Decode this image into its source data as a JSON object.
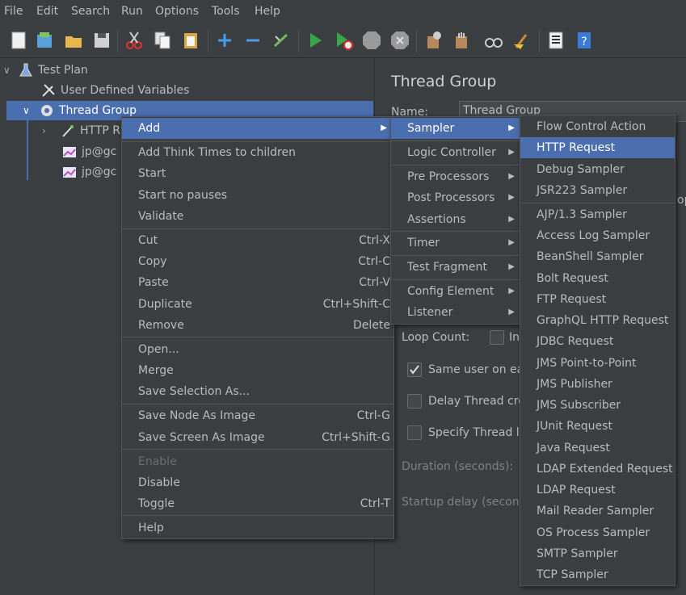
{
  "menubar": [
    "File",
    "Edit",
    "Search",
    "Run",
    "Options",
    "Tools",
    "Help"
  ],
  "toolbar_icons": [
    "new-icon",
    "templates-icon",
    "open-icon",
    "save-icon",
    "cut-icon",
    "copy-icon",
    "paste-icon",
    "expand-icon",
    "collapse-icon",
    "toggle-icon",
    "start-icon",
    "start-no-pauses-icon",
    "stop-icon",
    "shutdown-icon",
    "clear-icon",
    "clear-all-icon",
    "search-icon",
    "reset-search-icon",
    "function-helper-icon",
    "help-icon"
  ],
  "tree": {
    "test_plan": "Test Plan",
    "user_defined_variables": "User Defined Variables",
    "thread_group": "Thread Group",
    "http_request": "HTTP R",
    "jp1": "jp@gc",
    "jp2": "jp@gc"
  },
  "panel": {
    "title": "Thread Group",
    "name_label": "Name:",
    "name_value": "Thread Group",
    "loop_count_label": "Loop Count:",
    "infinite_label": "In",
    "same_user_label": "Same user on eac",
    "delay_thread_label": "Delay Thread cre",
    "specify_thread_label": "Specify Thread li",
    "duration_label": "Duration (seconds):",
    "startup_delay_label": "Startup delay (second",
    "op_fragment": "op"
  },
  "context_menu": {
    "add": "Add",
    "add_think_times": "Add Think Times to children",
    "start": "Start",
    "start_no_pauses": "Start no pauses",
    "validate": "Validate",
    "cut": "Cut",
    "cut_acc": "Ctrl-X",
    "copy": "Copy",
    "copy_acc": "Ctrl-C",
    "paste": "Paste",
    "paste_acc": "Ctrl-V",
    "duplicate": "Duplicate",
    "duplicate_acc": "Ctrl+Shift-C",
    "remove": "Remove",
    "remove_acc": "Delete",
    "open": "Open...",
    "merge": "Merge",
    "save_selection": "Save Selection As...",
    "save_node_image": "Save Node As Image",
    "save_node_image_acc": "Ctrl-G",
    "save_screen_image": "Save Screen As Image",
    "save_screen_image_acc": "Ctrl+Shift-G",
    "enable": "Enable",
    "disable": "Disable",
    "toggle": "Toggle",
    "toggle_acc": "Ctrl-T",
    "help": "Help"
  },
  "add_submenu": {
    "sampler": "Sampler",
    "logic_controller": "Logic Controller",
    "pre_processors": "Pre Processors",
    "post_processors": "Post Processors",
    "assertions": "Assertions",
    "timer": "Timer",
    "test_fragment": "Test Fragment",
    "config_element": "Config Element",
    "listener": "Listener"
  },
  "sampler_submenu": [
    "Flow Control Action",
    "HTTP Request",
    "Debug Sampler",
    "JSR223 Sampler",
    "AJP/1.3 Sampler",
    "Access Log Sampler",
    "BeanShell Sampler",
    "Bolt Request",
    "FTP Request",
    "GraphQL HTTP Request",
    "JDBC Request",
    "JMS Point-to-Point",
    "JMS Publisher",
    "JMS Subscriber",
    "JUnit Request",
    "Java Request",
    "LDAP Extended Request",
    "LDAP Request",
    "Mail Reader Sampler",
    "OS Process Sampler",
    "SMTP Sampler",
    "TCP Sampler"
  ],
  "colors": {
    "background": "#3c3f41",
    "selection": "#4b6eaf",
    "text": "#bbbbbb"
  }
}
